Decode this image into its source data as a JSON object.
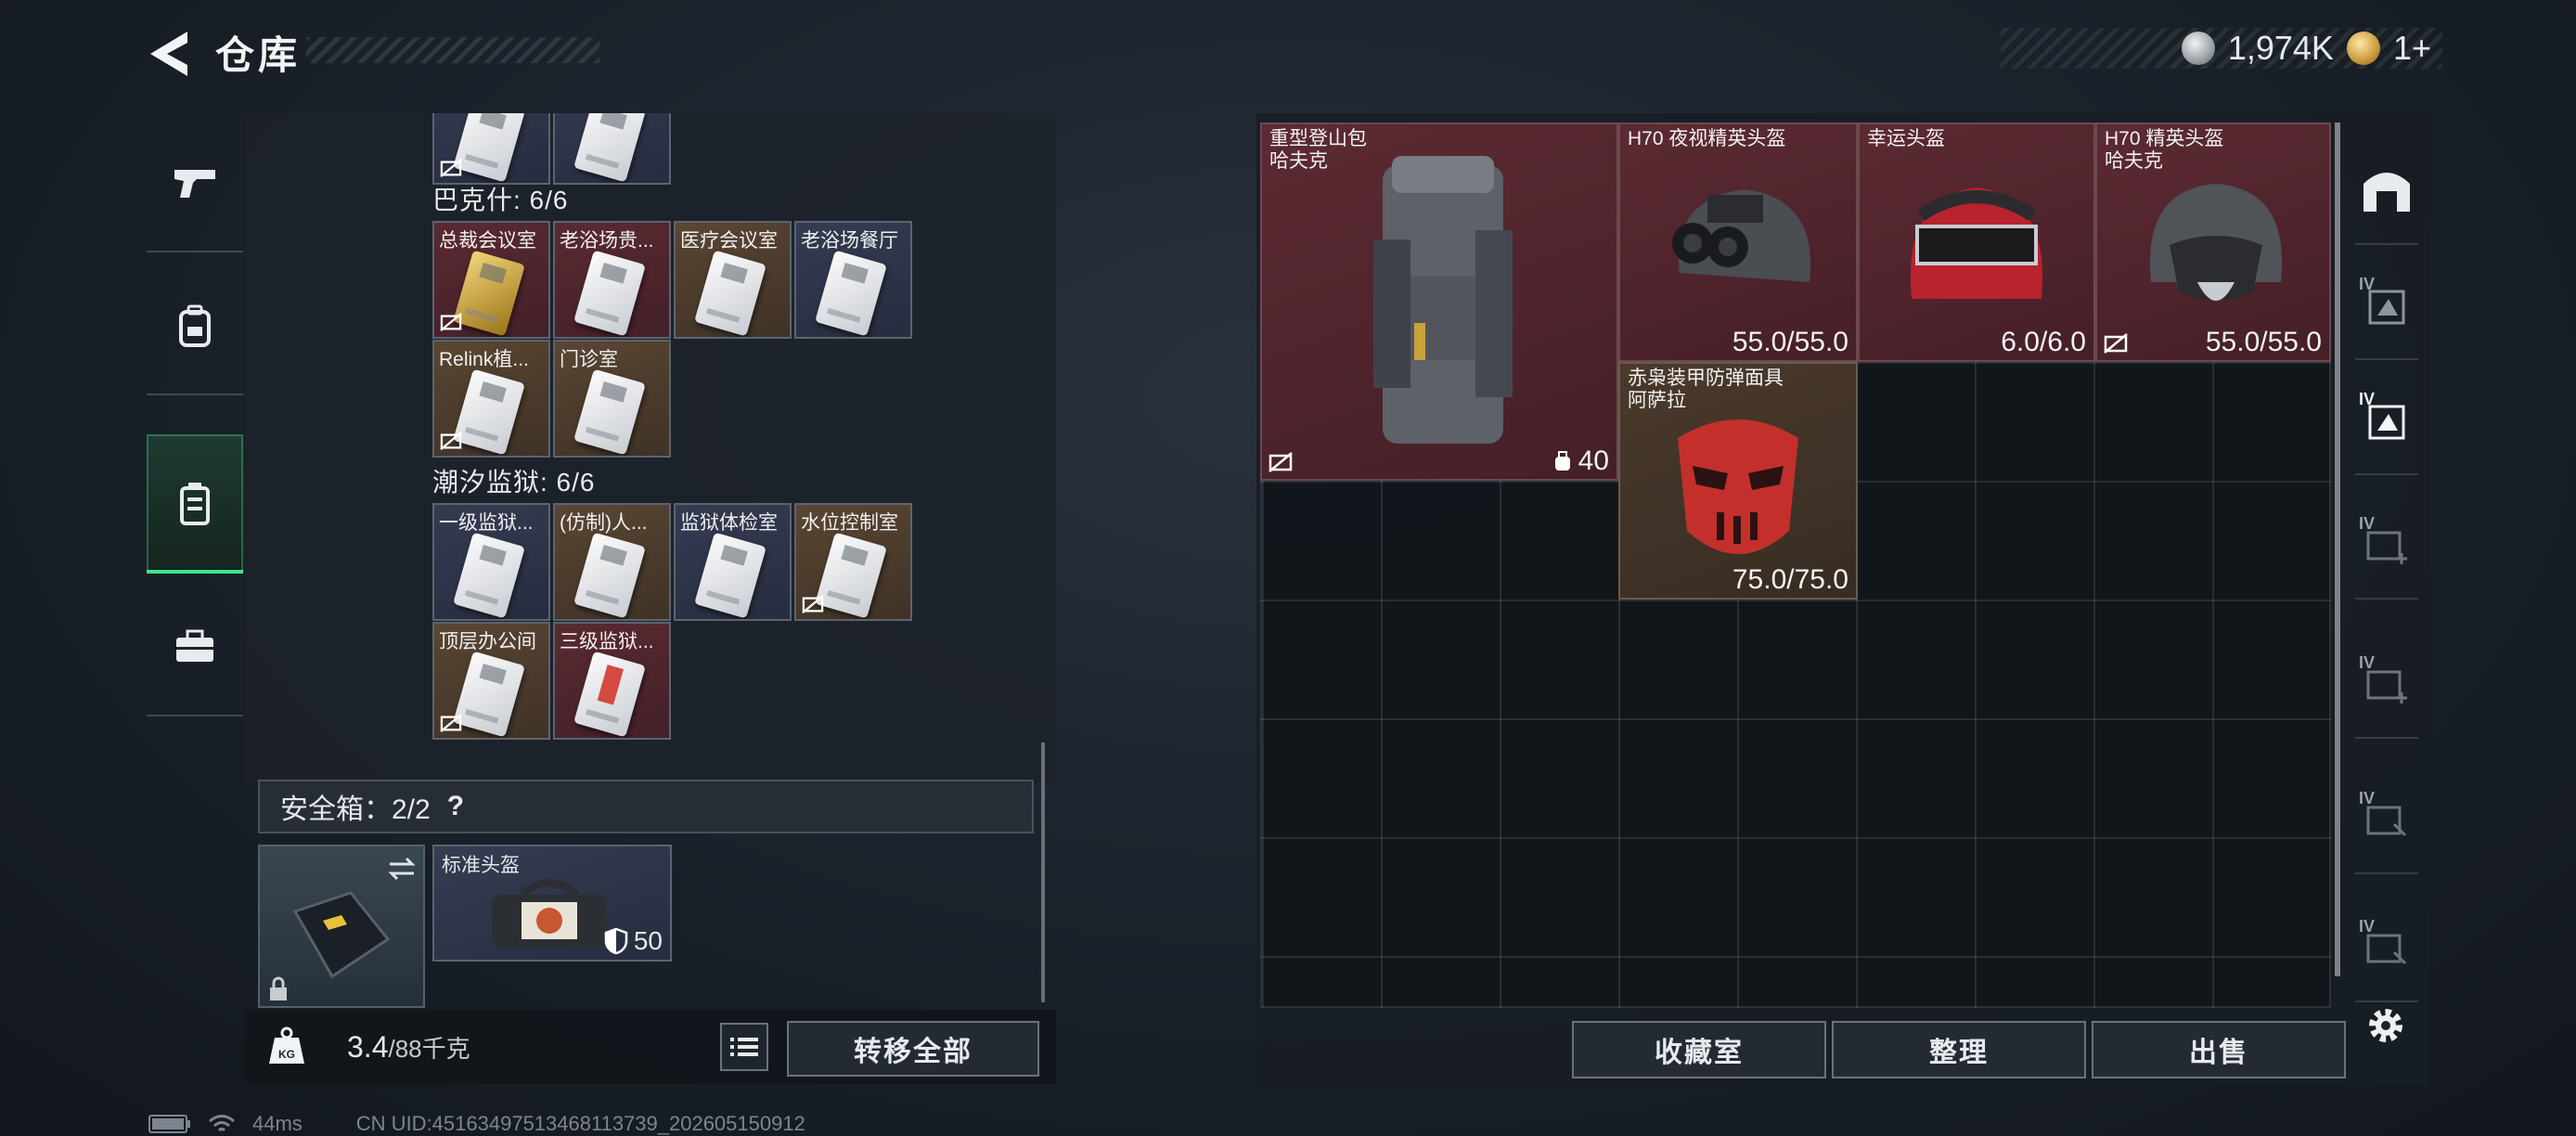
{
  "header": {
    "title": "仓库",
    "currency": [
      {
        "icon": "silver-coin-icon",
        "value": "1,974K"
      },
      {
        "icon": "gold-coin-icon",
        "value": "1+"
      }
    ]
  },
  "left_tabs": [
    {
      "icon": "pistol-icon",
      "active": false
    },
    {
      "icon": "backpack-icon",
      "active": false
    },
    {
      "icon": "keycard-case-icon",
      "active": true
    },
    {
      "icon": "briefcase-icon",
      "active": false
    }
  ],
  "key_groups": [
    {
      "title": "巴克什: 6/6",
      "cards": [
        {
          "label": "总裁会议室",
          "bg": "red",
          "gold": true,
          "nosell": true
        },
        {
          "label": "老浴场贵...",
          "bg": "red",
          "gold": false,
          "nosell": false
        },
        {
          "label": "医疗会议室",
          "bg": "brown",
          "gold": false,
          "nosell": false
        },
        {
          "label": "老浴场餐厅",
          "bg": "navy",
          "gold": false,
          "nosell": false
        },
        {
          "label": "Relink植...",
          "bg": "brown",
          "gold": false,
          "nosell": true
        },
        {
          "label": "门诊室",
          "bg": "brown",
          "gold": false,
          "nosell": false
        }
      ]
    },
    {
      "title": "潮汐监狱: 6/6",
      "cards": [
        {
          "label": "一级监狱...",
          "bg": "navy",
          "gold": false,
          "nosell": false
        },
        {
          "label": "(仿制)人...",
          "bg": "brown",
          "gold": false,
          "nosell": false
        },
        {
          "label": "监狱体检室",
          "bg": "navy",
          "gold": false,
          "nosell": false
        },
        {
          "label": "水位控制室",
          "bg": "brown",
          "gold": false,
          "nosell": true
        },
        {
          "label": "顶层办公间",
          "bg": "brown",
          "gold": false,
          "nosell": true
        },
        {
          "label": "三级监狱...",
          "bg": "red",
          "gold": false,
          "red_accent": true,
          "nosell": false
        }
      ]
    }
  ],
  "safe_box": {
    "label": "安全箱：2/2",
    "help": "?",
    "slot_item": {
      "label": "标准头盔",
      "value": "50"
    }
  },
  "weight": {
    "current": "3.4",
    "max": "/88千克"
  },
  "transfer_all": "转移全部",
  "stash_items": [
    {
      "name": "重型登山包\n哈夫克",
      "durability": "40",
      "type": "backpack",
      "nosell": true
    },
    {
      "name": "H70 夜视精英头盔",
      "durability": "55.0/55.0",
      "type": "helmet"
    },
    {
      "name": "幸运头盔",
      "durability": "6.0/6.0",
      "type": "helmet"
    },
    {
      "name": "H70 精英头盔\n哈夫克",
      "durability": "55.0/55.0",
      "type": "helmet",
      "nosell": true
    },
    {
      "name": "赤枭装甲防弹面具\n阿萨拉",
      "durability": "75.0/75.0",
      "type": "mask"
    }
  ],
  "bottom_buttons": [
    "收藏室",
    "整理",
    "出售"
  ],
  "right_tabs": [
    "home-icon",
    "IV",
    "IV",
    "IV",
    "IV",
    "IV",
    "IV"
  ],
  "status": {
    "ping": "44ms",
    "uid": "CN UID:451634975134681137​39_202605150912"
  },
  "colors": {
    "accent": "#3ee38c",
    "item_red": "#5c2a32",
    "item_brown": "#4a3a2c",
    "item_navy": "#353c52"
  }
}
